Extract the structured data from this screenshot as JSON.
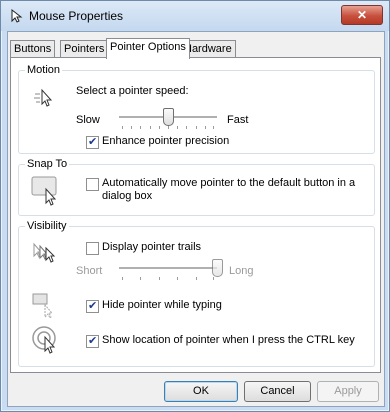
{
  "window": {
    "title": "Mouse Properties",
    "close_glyph": "✕"
  },
  "tabs": [
    "Buttons",
    "Pointers",
    "Pointer Options",
    "Hardware"
  ],
  "motion": {
    "label": "Motion",
    "speed_label": "Select a pointer speed:",
    "slow": "Slow",
    "fast": "Fast",
    "speed_level": 0.5,
    "precision_label": "Enhance pointer precision",
    "precision_checked": true
  },
  "snap_to": {
    "label": "Snap To",
    "auto_label": "Automatically move pointer to the default button in a dialog box",
    "auto_checked": false
  },
  "visibility": {
    "label": "Visibility",
    "trails_label": "Display pointer trails",
    "trails_checked": false,
    "short": "Short",
    "long": "Long",
    "trail_level": 1.0,
    "hide_label": "Hide pointer while typing",
    "hide_checked": true,
    "ctrl_label": "Show location of pointer when I press the CTRL key",
    "ctrl_checked": true
  },
  "buttons": {
    "ok": "OK",
    "cancel": "Cancel",
    "apply": "Apply"
  },
  "colors": {
    "title_bg": "#c4d8ef",
    "close_red": "#c7503d",
    "check": "#1c3a8c"
  }
}
